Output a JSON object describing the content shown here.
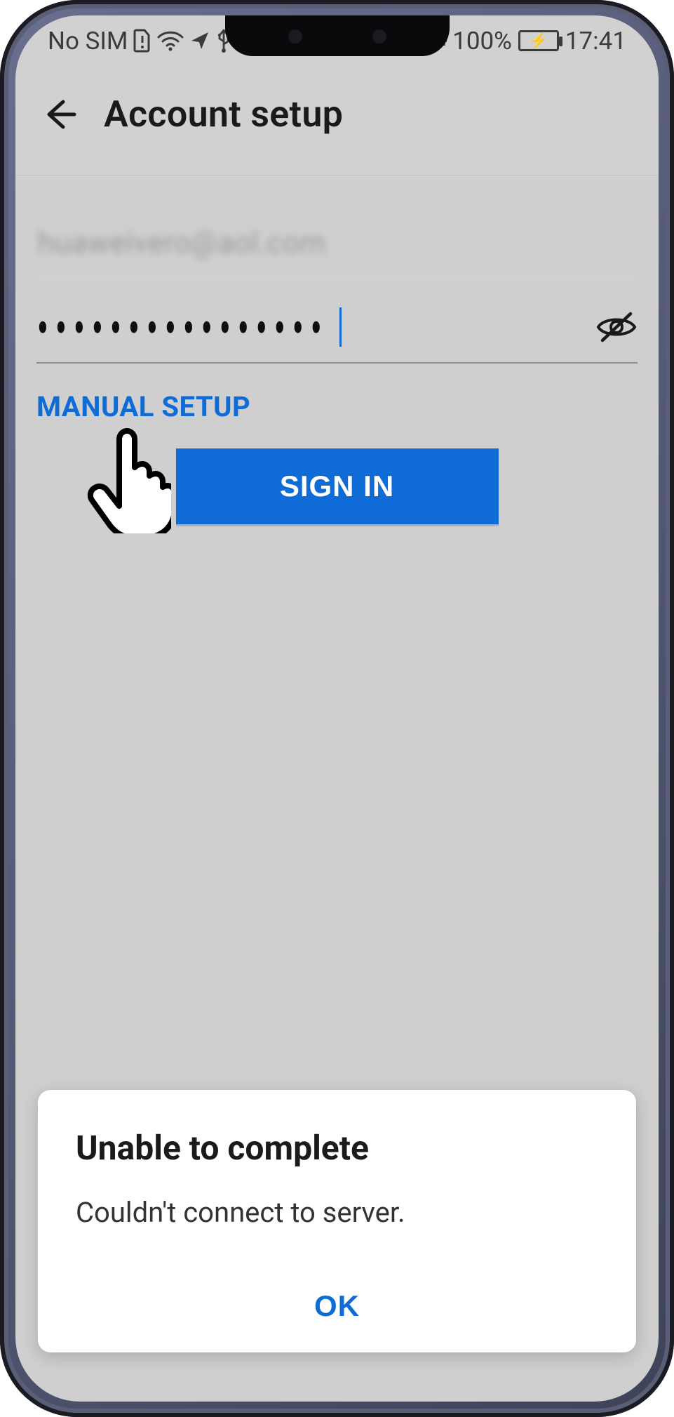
{
  "statusbar": {
    "sim": "No SIM",
    "battery_pct": "100%",
    "time": "17:41"
  },
  "header": {
    "title": "Account setup"
  },
  "form": {
    "email_value": "huaweivero@aol.com",
    "password_mask": "················",
    "manual_setup_label": "MANUAL SETUP",
    "signin_label": "SIGN IN"
  },
  "dialog": {
    "title": "Unable to complete",
    "message": "Couldn't connect to server.",
    "ok_label": "OK"
  },
  "icons": {
    "back": "back-arrow",
    "sim_warn": "sim-warning",
    "wifi": "wifi",
    "location": "location-send",
    "usb": "usb",
    "vpn_key": "vpn-key",
    "battery": "battery-charging",
    "eye_off": "visibility-off"
  },
  "colors": {
    "accent": "#0f6bd6",
    "bg": "#cfcfcf"
  }
}
